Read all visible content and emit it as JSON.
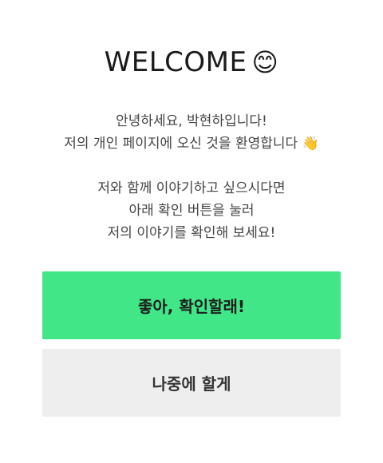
{
  "header": {
    "title": "WELCOME",
    "emoji": "😊"
  },
  "intro": {
    "line1": "안녕하세요, 박현하입니다!",
    "line2_text": "저의 개인 페이지에 오신 것을 환영합니다",
    "line2_emoji": "👋",
    "line3": "저와 함께 이야기하고 싶으시다면",
    "line4": "아래 확인 버튼을 눌러",
    "line5": "저의 이야기를 확인해 보세요!"
  },
  "buttons": {
    "confirm_label": "좋아, 확인할래!",
    "later_label": "나중에 할게"
  },
  "colors": {
    "confirm_bg": "#41e787",
    "later_bg": "#eeeeef",
    "text": "#222222"
  }
}
